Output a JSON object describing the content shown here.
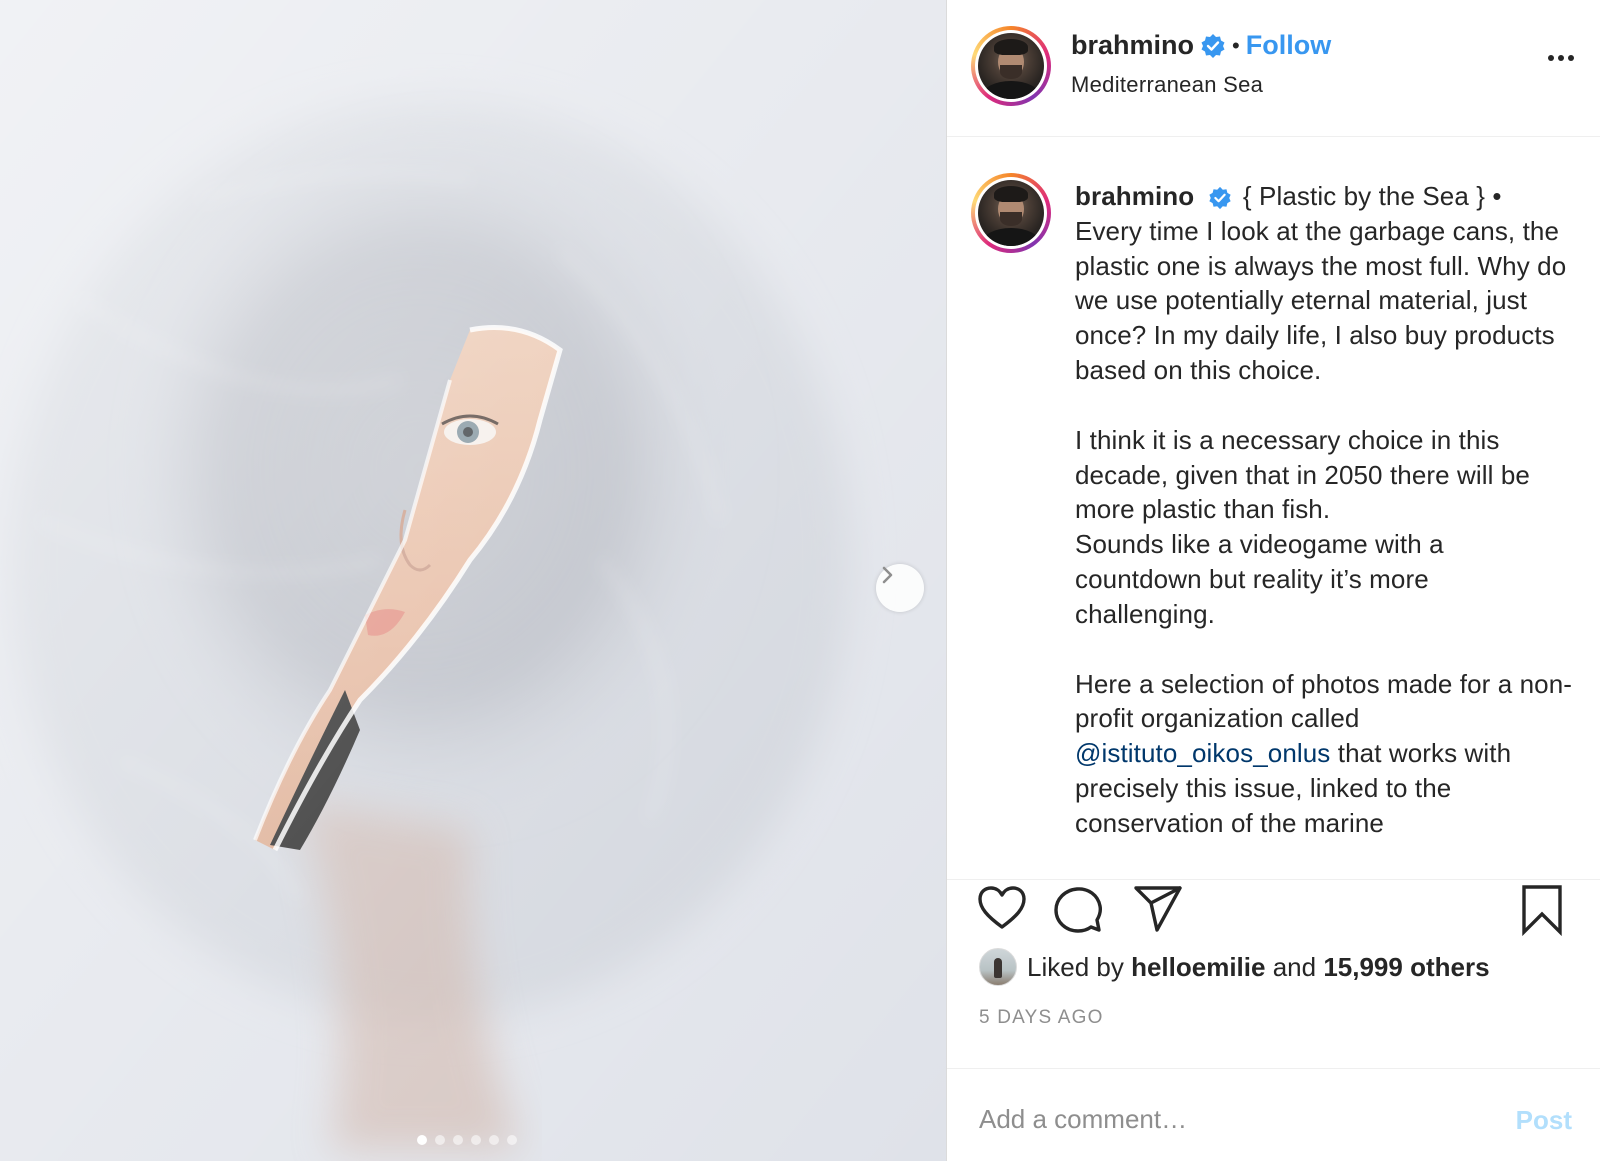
{
  "media": {
    "image_alt": "",
    "carousel": {
      "count": 6,
      "active_index": 0
    },
    "next_icon": "chevron-right-icon"
  },
  "header": {
    "username": "brahmino",
    "verified_icon": "verified-badge-icon",
    "separator": "•",
    "follow_label": "Follow",
    "location": "Mediterranean Sea",
    "more_icon": "more-options-icon"
  },
  "caption": {
    "username": "brahmino",
    "intro": "{ Plastic by the Sea } • Every time I look at the garbage cans, the plastic one is always the most full. Why do we use potentially eternal material, just once? In my daily life, I also buy products based on this choice.",
    "paragraph2": "I think it is a necessary choice in this decade, given that in 2050 there will be more plastic than fish.",
    "paragraph3": "Sounds like a videogame with a countdown but reality it’s more challenging.",
    "paragraph4_before": "Here a selection of photos made for a non-profit organization called",
    "mention": "@istituto_oikos_onlus",
    "paragraph4_after": "that works with precisely this issue, linked to the",
    "paragraph4_cut": "conservation of the marine"
  },
  "actions": {
    "like_icon": "heart-icon",
    "comment_icon": "comment-icon",
    "share_icon": "share-icon",
    "save_icon": "bookmark-icon"
  },
  "likes": {
    "prefix": "Liked by",
    "user": "helloemilie",
    "and": "and",
    "others": "15,999 others"
  },
  "timestamp": "5 DAYS AGO",
  "comment": {
    "placeholder": "Add a comment…",
    "post_label": "Post"
  },
  "colors": {
    "link_blue": "#3897f0",
    "mention_blue": "#00376b",
    "post_disabled": "#b2dffc",
    "muted_text": "#8e8e8e"
  }
}
